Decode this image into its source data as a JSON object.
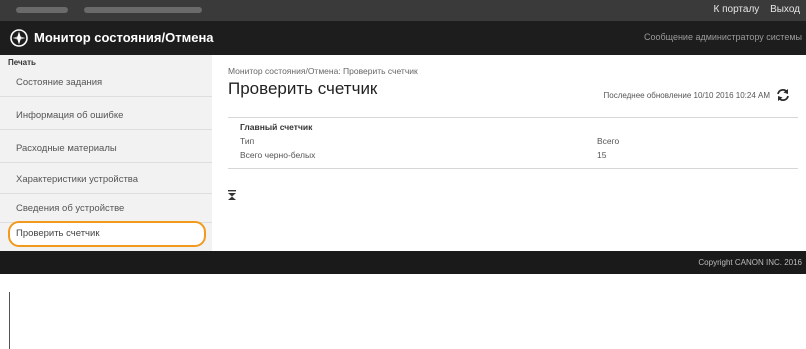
{
  "topbar": {
    "links": [
      "К порталу",
      "Выход"
    ]
  },
  "header": {
    "title": "Монитор состояния/Отмена",
    "admin_message": "Сообщение администратору системы",
    "icon": "compass-logo-icon"
  },
  "sidebar": {
    "section_label": "Печать",
    "items": [
      {
        "label": "Состояние задания"
      },
      {
        "label": "Информация об ошибке"
      },
      {
        "label": "Расходные материалы"
      },
      {
        "label": "Характеристики устройства"
      },
      {
        "label": "Сведения об устройстве"
      },
      {
        "label": "Проверить счетчик",
        "active": true
      }
    ],
    "highlight_color": "#f29a1d"
  },
  "main": {
    "breadcrumb": "Монитор состояния/Отмена: Проверить счетчик",
    "title": "Проверить счетчик",
    "last_update_label": "Последнее обновление 10/10 2016 10:24 AM",
    "table": {
      "heading": "Главный счетчик",
      "columns": [
        "Тип",
        "Всего"
      ],
      "rows": [
        [
          "Всего черно-белых",
          "15"
        ]
      ]
    }
  },
  "footer": {
    "copyright": "Copyright CANON INC. 2016"
  }
}
